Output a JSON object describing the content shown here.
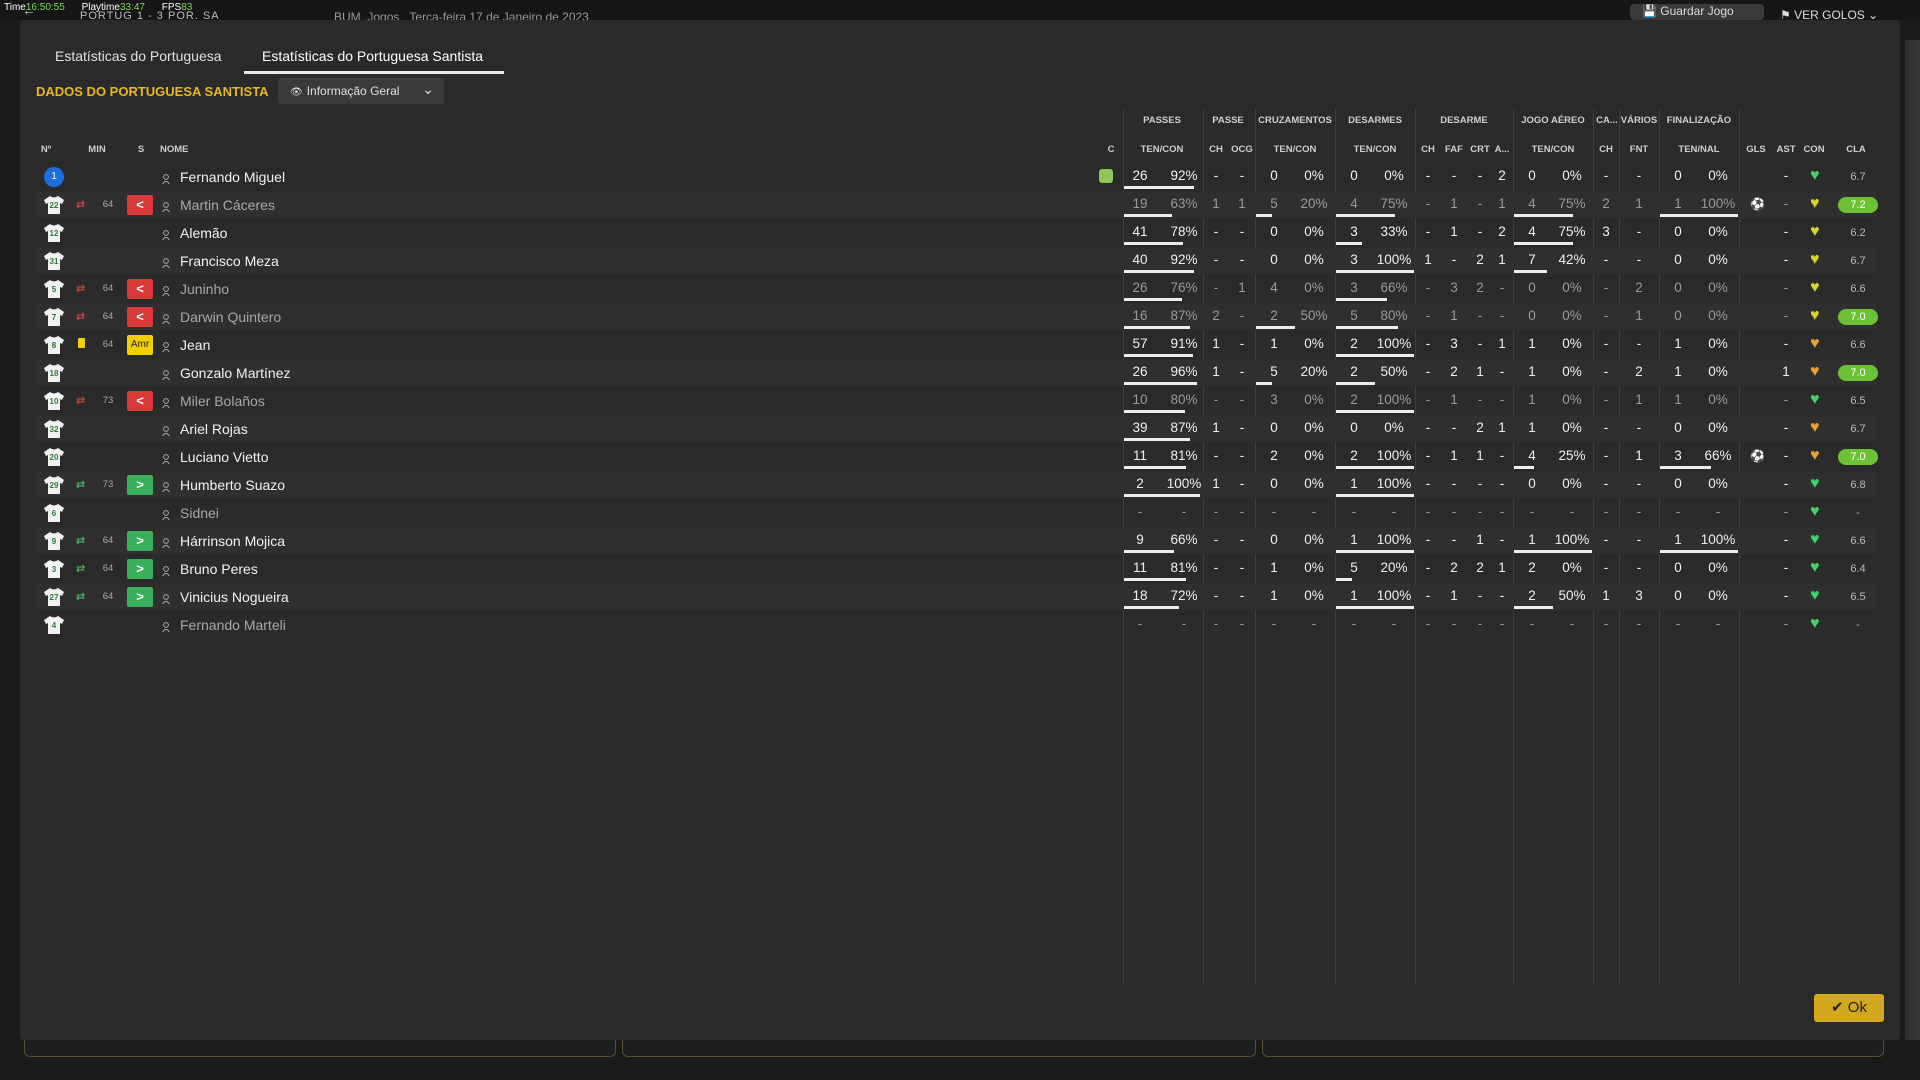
{
  "hud": {
    "time_label": "Time",
    "time": "16:50:55",
    "playtime_label": "Playtime",
    "playtime": "33:47",
    "fps_label": "FPS",
    "fps": "83"
  },
  "topbar": {
    "score": "PORTUG  1 - 3  POR. SA",
    "extra": "BUM_Jogos",
    "date": "Terça-feira 17 de Janeiro de 2023",
    "save_label": "Guardar Jogo",
    "goals_label": "VER GOLOS"
  },
  "tabs": [
    {
      "label": "Estatísticas do Portuguesa"
    },
    {
      "label": "Estatísticas do Portuguesa Santista"
    }
  ],
  "section_title": "DADOS DO PORTUGUESA SANTISTA",
  "view_dropdown": "Informação Geral",
  "group_headers": {
    "passes": "PASSES",
    "passe": "PASSE",
    "cruzamentos": "CRUZAMENTOS",
    "desarmes": "DESARMES",
    "desarme": "DESARME",
    "jogo_aereo": "JOGO AÉREO",
    "ca": "CA...",
    "varios": "VÁRIOS",
    "finalizacao": "FINALIZAÇÃO"
  },
  "column_headers": {
    "num": "Nº",
    "min": "MIN",
    "s": "S",
    "nome": "NOME",
    "c": "C",
    "passes": "TEN/CON",
    "passe_ch": "CH",
    "passe_ocg": "OCG",
    "cruz": "TEN/CON",
    "desarmes": "TEN/CON",
    "des_ch": "CH",
    "des_faf": "FAF",
    "des_crt": "CRT",
    "des_a": "A...",
    "aereo": "TEN/CON",
    "ca_ch": "CH",
    "varios_fnt": "FNT",
    "final": "TEN/NAL",
    "gls": "GLS",
    "ast": "AST",
    "con": "CON",
    "cla": "CLA"
  },
  "players": [
    {
      "num": "1",
      "min": "",
      "s": "",
      "name": "Fernando Miguel",
      "dim": false,
      "gk": true,
      "captain": true,
      "passes": [
        "26",
        "92%"
      ],
      "passes_bar": 0.92,
      "p_ch": "-",
      "p_ocg": "-",
      "cruz": [
        "0",
        "0%"
      ],
      "cruz_bar": 0,
      "des": [
        "0",
        "0%"
      ],
      "des_bar": 0,
      "d_ch": "-",
      "d_faf": "-",
      "d_crt": "-",
      "d_a": "2",
      "aereo": [
        "0",
        "0%"
      ],
      "aereo_bar": 0,
      "ca_ch": "-",
      "fnt": "-",
      "final": [
        "0",
        "0%"
      ],
      "final_bar": 0,
      "gls": "",
      "ast": "-",
      "con": "green",
      "cla": "6.7",
      "cla_hi": false
    },
    {
      "num": "22",
      "min": "64",
      "s": "out",
      "name": "Martin Cáceres",
      "dim": true,
      "passes": [
        "19",
        "63%"
      ],
      "passes_bar": 0.63,
      "p_ch": "1",
      "p_ocg": "1",
      "cruz": [
        "5",
        "20%"
      ],
      "cruz_bar": 0.2,
      "des": [
        "4",
        "75%"
      ],
      "des_bar": 0.75,
      "d_ch": "-",
      "d_faf": "1",
      "d_crt": "-",
      "d_a": "1",
      "aereo": [
        "4",
        "75%"
      ],
      "aereo_bar": 0.75,
      "ca_ch": "2",
      "fnt": "1",
      "final": [
        "1",
        "100%"
      ],
      "final_bar": 1,
      "gls": "ball",
      "ast": "-",
      "con": "yellow",
      "cla": "7.2",
      "cla_hi": true
    },
    {
      "num": "12",
      "min": "",
      "s": "",
      "name": "Alemão",
      "dim": false,
      "passes": [
        "41",
        "78%"
      ],
      "passes_bar": 0.78,
      "p_ch": "-",
      "p_ocg": "-",
      "cruz": [
        "0",
        "0%"
      ],
      "cruz_bar": 0,
      "des": [
        "3",
        "33%"
      ],
      "des_bar": 0.33,
      "d_ch": "-",
      "d_faf": "1",
      "d_crt": "-",
      "d_a": "2",
      "aereo": [
        "4",
        "75%"
      ],
      "aereo_bar": 0.75,
      "ca_ch": "3",
      "fnt": "-",
      "final": [
        "0",
        "0%"
      ],
      "final_bar": 0,
      "gls": "",
      "ast": "-",
      "con": "yellow",
      "cla": "6.2",
      "cla_hi": false
    },
    {
      "num": "31",
      "min": "",
      "s": "",
      "name": "Francisco Meza",
      "dim": false,
      "passes": [
        "40",
        "92%"
      ],
      "passes_bar": 0.92,
      "p_ch": "-",
      "p_ocg": "-",
      "cruz": [
        "0",
        "0%"
      ],
      "cruz_bar": 0,
      "des": [
        "3",
        "100%"
      ],
      "des_bar": 1,
      "d_ch": "1",
      "d_faf": "-",
      "d_crt": "2",
      "d_a": "1",
      "aereo": [
        "7",
        "42%"
      ],
      "aereo_bar": 0.42,
      "ca_ch": "-",
      "fnt": "-",
      "final": [
        "0",
        "0%"
      ],
      "final_bar": 0,
      "gls": "",
      "ast": "-",
      "con": "yellow",
      "cla": "6.7",
      "cla_hi": false
    },
    {
      "num": "5",
      "min": "64",
      "s": "out",
      "name": "Juninho",
      "dim": true,
      "passes": [
        "26",
        "76%"
      ],
      "passes_bar": 0.76,
      "p_ch": "-",
      "p_ocg": "1",
      "cruz": [
        "4",
        "0%"
      ],
      "cruz_bar": 0,
      "des": [
        "3",
        "66%"
      ],
      "des_bar": 0.66,
      "d_ch": "-",
      "d_faf": "3",
      "d_crt": "2",
      "d_a": "-",
      "aereo": [
        "0",
        "0%"
      ],
      "aereo_bar": 0,
      "ca_ch": "-",
      "fnt": "2",
      "final": [
        "0",
        "0%"
      ],
      "final_bar": 0,
      "gls": "",
      "ast": "-",
      "con": "yellow",
      "cla": "6.6",
      "cla_hi": false
    },
    {
      "num": "7",
      "min": "64",
      "s": "out",
      "name": "Darwin Quintero",
      "dim": true,
      "passes": [
        "16",
        "87%"
      ],
      "passes_bar": 0.87,
      "p_ch": "2",
      "p_ocg": "-",
      "cruz": [
        "2",
        "50%"
      ],
      "cruz_bar": 0.5,
      "des": [
        "5",
        "80%"
      ],
      "des_bar": 0.8,
      "d_ch": "-",
      "d_faf": "1",
      "d_crt": "-",
      "d_a": "-",
      "aereo": [
        "0",
        "0%"
      ],
      "aereo_bar": 0,
      "ca_ch": "-",
      "fnt": "1",
      "final": [
        "0",
        "0%"
      ],
      "final_bar": 0,
      "gls": "",
      "ast": "-",
      "con": "yellow",
      "cla": "7.0",
      "cla_hi": true
    },
    {
      "num": "8",
      "min": "64",
      "s": "yellow",
      "name": "Jean",
      "dim": false,
      "ycard": true,
      "passes": [
        "57",
        "91%"
      ],
      "passes_bar": 0.91,
      "p_ch": "1",
      "p_ocg": "-",
      "cruz": [
        "1",
        "0%"
      ],
      "cruz_bar": 0,
      "des": [
        "2",
        "100%"
      ],
      "des_bar": 1,
      "d_ch": "-",
      "d_faf": "3",
      "d_crt": "-",
      "d_a": "1",
      "aereo": [
        "1",
        "0%"
      ],
      "aereo_bar": 0,
      "ca_ch": "-",
      "fnt": "-",
      "final": [
        "1",
        "0%"
      ],
      "final_bar": 0,
      "gls": "",
      "ast": "-",
      "con": "orange",
      "cla": "6.6",
      "cla_hi": false
    },
    {
      "num": "18",
      "min": "",
      "s": "",
      "name": "Gonzalo Martínez",
      "dim": false,
      "passes": [
        "26",
        "96%"
      ],
      "passes_bar": 0.96,
      "p_ch": "1",
      "p_ocg": "-",
      "cruz": [
        "5",
        "20%"
      ],
      "cruz_bar": 0.2,
      "des": [
        "2",
        "50%"
      ],
      "des_bar": 0.5,
      "d_ch": "-",
      "d_faf": "2",
      "d_crt": "1",
      "d_a": "-",
      "aereo": [
        "1",
        "0%"
      ],
      "aereo_bar": 0,
      "ca_ch": "-",
      "fnt": "2",
      "final": [
        "1",
        "0%"
      ],
      "final_bar": 0,
      "gls": "",
      "ast": "1",
      "con": "orange",
      "cla": "7.0",
      "cla_hi": true
    },
    {
      "num": "10",
      "min": "73",
      "s": "out",
      "name": "Miler Bolaños",
      "dim": true,
      "passes": [
        "10",
        "80%"
      ],
      "passes_bar": 0.8,
      "p_ch": "-",
      "p_ocg": "-",
      "cruz": [
        "3",
        "0%"
      ],
      "cruz_bar": 0,
      "des": [
        "2",
        "100%"
      ],
      "des_bar": 1,
      "d_ch": "-",
      "d_faf": "1",
      "d_crt": "-",
      "d_a": "-",
      "aereo": [
        "1",
        "0%"
      ],
      "aereo_bar": 0,
      "ca_ch": "-",
      "fnt": "1",
      "final": [
        "1",
        "0%"
      ],
      "final_bar": 0,
      "gls": "",
      "ast": "-",
      "con": "green",
      "cla": "6.5",
      "cla_hi": false
    },
    {
      "num": "32",
      "min": "",
      "s": "",
      "name": "Ariel Rojas",
      "dim": false,
      "passes": [
        "39",
        "87%"
      ],
      "passes_bar": 0.87,
      "p_ch": "1",
      "p_ocg": "-",
      "cruz": [
        "0",
        "0%"
      ],
      "cruz_bar": 0,
      "des": [
        "0",
        "0%"
      ],
      "des_bar": 0,
      "d_ch": "-",
      "d_faf": "-",
      "d_crt": "2",
      "d_a": "1",
      "aereo": [
        "1",
        "0%"
      ],
      "aereo_bar": 0,
      "ca_ch": "-",
      "fnt": "-",
      "final": [
        "0",
        "0%"
      ],
      "final_bar": 0,
      "gls": "",
      "ast": "-",
      "con": "orange",
      "cla": "6.7",
      "cla_hi": false
    },
    {
      "num": "20",
      "min": "",
      "s": "",
      "name": "Luciano Vietto",
      "dim": false,
      "passes": [
        "11",
        "81%"
      ],
      "passes_bar": 0.81,
      "p_ch": "-",
      "p_ocg": "-",
      "cruz": [
        "2",
        "0%"
      ],
      "cruz_bar": 0,
      "des": [
        "2",
        "100%"
      ],
      "des_bar": 1,
      "d_ch": "-",
      "d_faf": "1",
      "d_crt": "1",
      "d_a": "-",
      "aereo": [
        "4",
        "25%"
      ],
      "aereo_bar": 0.25,
      "ca_ch": "-",
      "fnt": "1",
      "final": [
        "3",
        "66%"
      ],
      "final_bar": 0.66,
      "gls": "ball",
      "ast": "-",
      "con": "orange",
      "cla": "7.0",
      "cla_hi": true
    },
    {
      "num": "29",
      "min": "73",
      "s": "in",
      "name": "Humberto Suazo",
      "dim": false,
      "passes": [
        "2",
        "100%"
      ],
      "passes_bar": 1,
      "p_ch": "1",
      "p_ocg": "-",
      "cruz": [
        "0",
        "0%"
      ],
      "cruz_bar": 0,
      "des": [
        "1",
        "100%"
      ],
      "des_bar": 1,
      "d_ch": "-",
      "d_faf": "-",
      "d_crt": "-",
      "d_a": "-",
      "aereo": [
        "0",
        "0%"
      ],
      "aereo_bar": 0,
      "ca_ch": "-",
      "fnt": "-",
      "final": [
        "0",
        "0%"
      ],
      "final_bar": 0,
      "gls": "",
      "ast": "-",
      "con": "green",
      "cla": "6.8",
      "cla_hi": false
    },
    {
      "num": "6",
      "min": "",
      "s": "",
      "name": "Sidnei",
      "dim": true,
      "passes": [
        "-",
        "-"
      ],
      "passes_bar": 0,
      "p_ch": "-",
      "p_ocg": "-",
      "cruz": [
        "-",
        "-"
      ],
      "cruz_bar": 0,
      "des": [
        "-",
        "-"
      ],
      "des_bar": 0,
      "d_ch": "-",
      "d_faf": "-",
      "d_crt": "-",
      "d_a": "-",
      "aereo": [
        "-",
        "-"
      ],
      "aereo_bar": 0,
      "ca_ch": "-",
      "fnt": "-",
      "final": [
        "-",
        "-"
      ],
      "final_bar": 0,
      "gls": "",
      "ast": "-",
      "con": "green",
      "cla": "-",
      "cla_hi": false
    },
    {
      "num": "9",
      "min": "64",
      "s": "in",
      "name": "Hárrinson Mojica",
      "dim": false,
      "passes": [
        "9",
        "66%"
      ],
      "passes_bar": 0.66,
      "p_ch": "-",
      "p_ocg": "-",
      "cruz": [
        "0",
        "0%"
      ],
      "cruz_bar": 0,
      "des": [
        "1",
        "100%"
      ],
      "des_bar": 1,
      "d_ch": "-",
      "d_faf": "-",
      "d_crt": "1",
      "d_a": "-",
      "aereo": [
        "1",
        "100%"
      ],
      "aereo_bar": 1,
      "ca_ch": "-",
      "fnt": "-",
      "final": [
        "1",
        "100%"
      ],
      "final_bar": 1,
      "gls": "",
      "ast": "-",
      "con": "green",
      "cla": "6.6",
      "cla_hi": false
    },
    {
      "num": "3",
      "min": "64",
      "s": "in",
      "name": "Bruno Peres",
      "dim": false,
      "passes": [
        "11",
        "81%"
      ],
      "passes_bar": 0.81,
      "p_ch": "-",
      "p_ocg": "-",
      "cruz": [
        "1",
        "0%"
      ],
      "cruz_bar": 0,
      "des": [
        "5",
        "20%"
      ],
      "des_bar": 0.2,
      "d_ch": "-",
      "d_faf": "2",
      "d_crt": "2",
      "d_a": "1",
      "aereo": [
        "2",
        "0%"
      ],
      "aereo_bar": 0,
      "ca_ch": "-",
      "fnt": "-",
      "final": [
        "0",
        "0%"
      ],
      "final_bar": 0,
      "gls": "",
      "ast": "-",
      "con": "green",
      "cla": "6.4",
      "cla_hi": false
    },
    {
      "num": "27",
      "min": "64",
      "s": "in",
      "name": "Vinicius Nogueira",
      "dim": false,
      "passes": [
        "18",
        "72%"
      ],
      "passes_bar": 0.72,
      "p_ch": "-",
      "p_ocg": "-",
      "cruz": [
        "1",
        "0%"
      ],
      "cruz_bar": 0,
      "des": [
        "1",
        "100%"
      ],
      "des_bar": 1,
      "d_ch": "-",
      "d_faf": "1",
      "d_crt": "-",
      "d_a": "-",
      "aereo": [
        "2",
        "50%"
      ],
      "aereo_bar": 0.5,
      "ca_ch": "1",
      "fnt": "3",
      "final": [
        "0",
        "0%"
      ],
      "final_bar": 0,
      "gls": "",
      "ast": "-",
      "con": "green",
      "cla": "6.5",
      "cla_hi": false
    },
    {
      "num": "4",
      "min": "",
      "s": "",
      "name": "Fernando Marteli",
      "dim": true,
      "passes": [
        "-",
        "-"
      ],
      "passes_bar": 0,
      "p_ch": "-",
      "p_ocg": "-",
      "cruz": [
        "-",
        "-"
      ],
      "cruz_bar": 0,
      "des": [
        "-",
        "-"
      ],
      "des_bar": 0,
      "d_ch": "-",
      "d_faf": "-",
      "d_crt": "-",
      "d_a": "-",
      "aereo": [
        "-",
        "-"
      ],
      "aereo_bar": 0,
      "ca_ch": "-",
      "fnt": "-",
      "final": [
        "-",
        "-"
      ],
      "final_bar": 0,
      "gls": "",
      "ast": "-",
      "con": "green",
      "cla": "-",
      "cla_hi": false
    }
  ],
  "colors": {
    "accent": "#e8b923",
    "rating_high": "#6cc135",
    "sub_out": "#d83a3a",
    "sub_in": "#3bb05a",
    "con_green": "#3fd16a",
    "con_yellow": "#d6d42a",
    "con_orange": "#e8a030"
  },
  "icons": {
    "substitution": "swap-arrows-icon",
    "goal": "football-icon",
    "condition": "heart-icon",
    "captain": "captain-armband-icon",
    "back": "back-arrow-icon",
    "save": "floppy-icon",
    "goals": "flag-icon"
  },
  "ok_label": "Ok"
}
